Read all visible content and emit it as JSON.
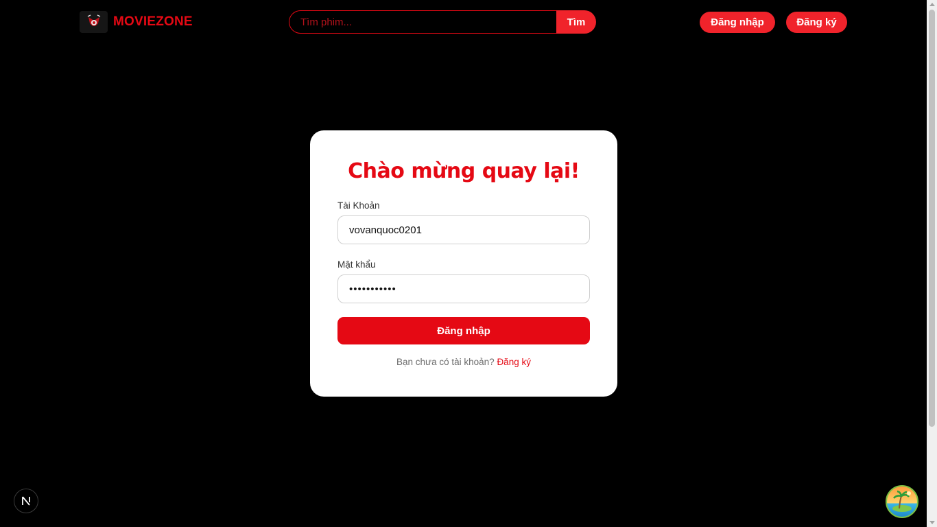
{
  "header": {
    "brand": "MOVIEZONE",
    "search_placeholder": "Tìm phim...",
    "search_button": "Tìm",
    "login_button": "Đăng nhập",
    "register_button": "Đăng ký"
  },
  "login_form": {
    "title": "Chào mừng quay lại!",
    "username_label": "Tài Khoản",
    "username_value": "vovanquoc0201",
    "password_label": "Mật khẩu",
    "password_value": "•••••••••••",
    "submit_label": "Đăng nhập",
    "no_account_text": "Bạn chưa có tài khoản?",
    "register_link": "Đăng ký"
  },
  "icons": {
    "logo": "movie-logo-icon",
    "dev_badge": "nextjs-icon",
    "extension": "island-avatar-icon"
  },
  "colors": {
    "accent": "#e50914",
    "accent_button": "#f0232b",
    "background": "#000000",
    "card": "#ffffff"
  }
}
